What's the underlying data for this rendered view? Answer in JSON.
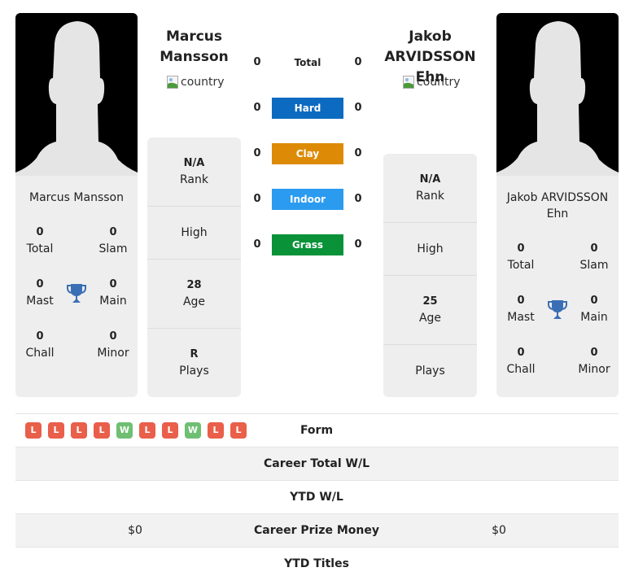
{
  "colors": {
    "hard": "#0c6bc0",
    "clay": "#dd8b06",
    "indoor": "#2b9bf0",
    "grass": "#0a9239",
    "loss": "#e95f4a",
    "win": "#6fbf73",
    "trophy": "#3a6fb5"
  },
  "player1": {
    "name_line1": "Marcus",
    "name_line2": "Mansson",
    "card_name": "Marcus Mansson",
    "country_alt": "country",
    "stats": {
      "total": "0",
      "total_label": "Total",
      "slam": "0",
      "slam_label": "Slam",
      "mast": "0",
      "mast_label": "Mast",
      "main": "0",
      "main_label": "Main",
      "chall": "0",
      "chall_label": "Chall",
      "minor": "0",
      "minor_label": "Minor"
    },
    "info": {
      "rank_value": "N/A",
      "rank_label": "Rank",
      "high_label": "High",
      "age_value": "28",
      "age_label": "Age",
      "plays_value": "R",
      "plays_label": "Plays"
    }
  },
  "player2": {
    "name_line1": "Jakob",
    "name_line2": "ARVIDSSON Ehn",
    "card_name_line1": "Jakob ARVIDSSON",
    "card_name_line2": "Ehn",
    "country_alt": "country",
    "stats": {
      "total": "0",
      "total_label": "Total",
      "slam": "0",
      "slam_label": "Slam",
      "mast": "0",
      "mast_label": "Mast",
      "main": "0",
      "main_label": "Main",
      "chall": "0",
      "chall_label": "Chall",
      "minor": "0",
      "minor_label": "Minor"
    },
    "info": {
      "rank_value": "N/A",
      "rank_label": "Rank",
      "high_label": "High",
      "age_value": "25",
      "age_label": "Age",
      "plays_value": "",
      "plays_label": "Plays"
    }
  },
  "surfaces": [
    {
      "name": "Total",
      "left": "0",
      "right": "0"
    },
    {
      "name": "Hard",
      "left": "0",
      "right": "0"
    },
    {
      "name": "Clay",
      "left": "0",
      "right": "0"
    },
    {
      "name": "Indoor",
      "left": "0",
      "right": "0"
    },
    {
      "name": "Grass",
      "left": "0",
      "right": "0"
    }
  ],
  "form": [
    "L",
    "L",
    "L",
    "L",
    "W",
    "L",
    "L",
    "W",
    "L",
    "L"
  ],
  "table": [
    {
      "label": "Form",
      "left": "",
      "right": ""
    },
    {
      "label": "Career Total W/L",
      "left": "",
      "right": ""
    },
    {
      "label": "YTD W/L",
      "left": "",
      "right": ""
    },
    {
      "label": "Career Prize Money",
      "left": "$0",
      "right": "$0"
    },
    {
      "label": "YTD Titles",
      "left": "",
      "right": ""
    }
  ]
}
